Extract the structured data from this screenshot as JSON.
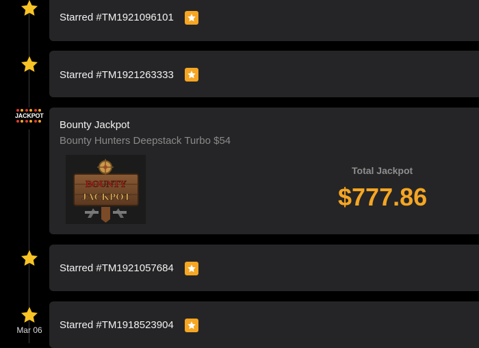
{
  "timeline": {
    "items": [
      {
        "type": "starred",
        "label": "Starred #TM1921096101"
      },
      {
        "type": "starred",
        "label": "Starred #TM1921263333"
      },
      {
        "type": "jackpot",
        "title": "Bounty Jackpot",
        "subtitle": "Bounty Hunters Deepstack Turbo $54",
        "icon_text": "JACKPOT",
        "thumbnail_text": [
          "BOUNTY",
          "JACKPOT"
        ],
        "total_label": "Total Jackpot",
        "total_value": "$777.86"
      },
      {
        "type": "starred",
        "label": "Starred #TM1921057684"
      },
      {
        "type": "starred",
        "label": "Starred #TM1918523904",
        "date": "Mar 06"
      }
    ]
  },
  "colors": {
    "background": "#000000",
    "card": "#252527",
    "accent": "#f5a623"
  },
  "icons": {
    "timeline_star": "star-icon",
    "badge_star": "star-badge-icon",
    "jackpot": "jackpot-icon"
  }
}
